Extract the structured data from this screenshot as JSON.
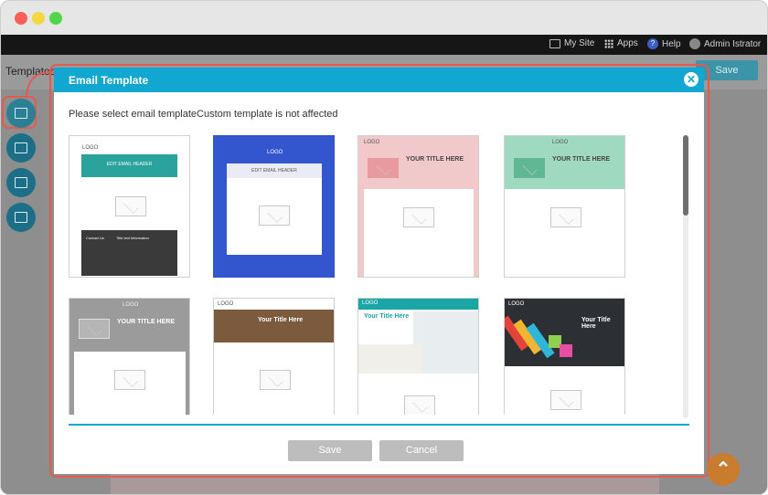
{
  "topbar": {
    "my_site": "My Site",
    "apps": "Apps",
    "help": "Help",
    "user": "Admin Istrator"
  },
  "background": {
    "page_title": "Templates",
    "save_label": "Save"
  },
  "modal": {
    "title": "Email Template",
    "instruction": "Please select email templateCustom template is not affected",
    "save_label": "Save",
    "cancel_label": "Cancel"
  },
  "templates": [
    {
      "header_text": "EDIT EMAIL HEADER",
      "logo": "LOGO",
      "footer_heading": "Contact Us",
      "footer_title": "Title text information"
    },
    {
      "header_text": "EDIT EMAIL HEADER",
      "logo": "LOGO"
    },
    {
      "title": "YOUR TITLE HERE",
      "logo": "LOGO"
    },
    {
      "title": "YOUR TITLE HERE",
      "logo": "LOGO"
    },
    {
      "title": "YOUR TITLE HERE",
      "logo": "LOGO"
    },
    {
      "title": "Your Title Here",
      "logo": "LOGO"
    },
    {
      "title": "Your Title Here",
      "logo": "LOGO"
    },
    {
      "title": "Your Title Here",
      "logo": "LOGO"
    }
  ],
  "colors": {
    "accent": "#11a7d1",
    "highlight": "#e45a50",
    "button_disabled": "#bdbdbd"
  }
}
